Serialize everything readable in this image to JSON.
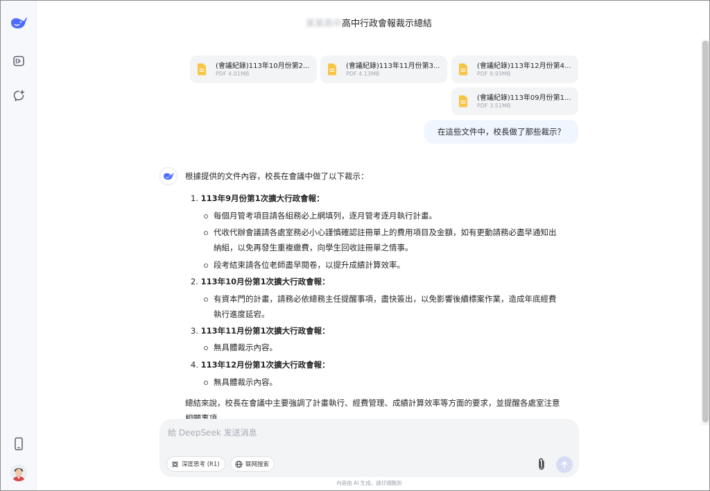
{
  "header": {
    "title_blurred_prefix": "某某高中",
    "title": "高中行政會報裁示總結"
  },
  "files": [
    {
      "name": "(會議紀錄)113年10月份第2...",
      "meta": "PDF 4.01MB"
    },
    {
      "name": "(會議紀錄)113年11月份第3...",
      "meta": "PDF 4.13MB"
    },
    {
      "name": "(會議紀錄)113年12月份第4...",
      "meta": "PDF 9.93MB"
    },
    {
      "name": "(會議紀錄)113年09月份第1...",
      "meta": "PDF 3.51MB"
    }
  ],
  "user_message": "在這些文件中，校長做了那些裁示？",
  "answer": {
    "intro": "根據提供的文件內容，校長在會議中做了以下裁示：",
    "items": [
      {
        "number": "1.",
        "heading": "113年9月份第1次擴大行政會報：",
        "bullets": [
          [
            "每個月管考項目請各組務必上網填列，逐月管考逐月執行計畫。"
          ],
          [
            "代收代辦會議請各處室務必小心謹慎確認註冊單上的費用項目及金額，如有更動請務必盡早通知出",
            "納組，以免再發生重複繳費，向學生回收註冊單之情事。"
          ],
          [
            "段考結束請各位老師盡早閱卷，以提升成績計算效率。"
          ]
        ]
      },
      {
        "number": "2.",
        "heading": "113年10月份第1次擴大行政會報：",
        "bullets": [
          [
            "有資本門的計畫，請務必依總務主任提醒事項，盡快簽出，以免影響後續標案作業，造成年底經費",
            "執行進度延宕。"
          ]
        ]
      },
      {
        "number": "3.",
        "heading": "113年11月份第1次擴大行政會報：",
        "bullets": [
          [
            "無具體裁示內容。"
          ]
        ]
      },
      {
        "number": "4.",
        "heading": "113年12月份第1次擴大行政會報：",
        "bullets": [
          [
            "無具體裁示內容。"
          ]
        ]
      }
    ],
    "summary_line1": "總結來說，校長在會議中主要強調了計畫執行、經費管理、成績計算效率等方面的要求，並提醒各處室注意",
    "summary_line2": "相關事項。"
  },
  "composer": {
    "placeholder": "給 DeepSeek 发送消息",
    "deep_think_label": "深度思考 (R1)",
    "web_search_label": "联网搜索"
  },
  "footer_note": "內容由 AI 生成，請仔細甄別",
  "icons": {
    "logo": "deepseek-whale-icon",
    "open_sidebar": "sidebar-toggle-icon",
    "new_chat": "new-chat-icon",
    "mobile": "mobile-phone-icon",
    "file": "document-icon",
    "deep_think": "atom-icon",
    "web_search": "globe-icon",
    "attach": "paperclip-icon",
    "send": "arrow-up-icon"
  },
  "colors": {
    "brand": "#4d6bfe",
    "file_icon": "#f6c544",
    "user_bubble": "#eff6ff",
    "composer_bg": "#f3f4f6",
    "send_disabled": "#d6dcf3"
  }
}
